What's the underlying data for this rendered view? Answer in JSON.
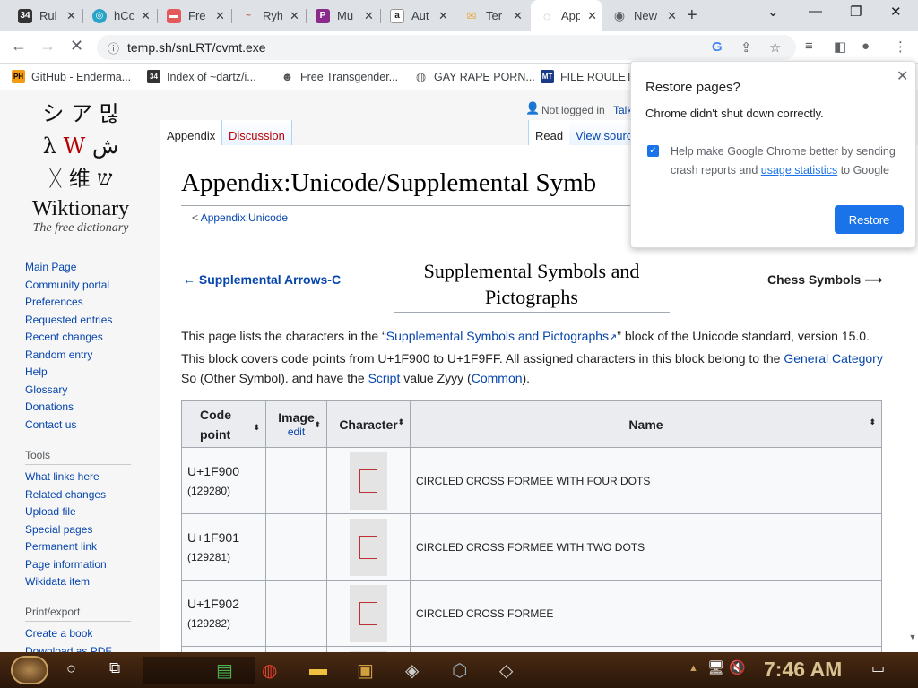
{
  "browser": {
    "tabs": [
      {
        "label": "Rul",
        "favicon": "34",
        "favicon_color": "#333333"
      },
      {
        "label": "hCo",
        "favicon": "◎",
        "favicon_color": "#2aa3c9"
      },
      {
        "label": "Fre",
        "favicon": "▬",
        "favicon_color": "#e45a5a"
      },
      {
        "label": "Ryh",
        "favicon": "~",
        "favicon_color": "#c06060"
      },
      {
        "label": "Mu",
        "favicon": "P",
        "favicon_color": "#8a2a8a"
      },
      {
        "label": "Aut",
        "favicon": "a",
        "favicon_color": "#222222"
      },
      {
        "label": "Ter",
        "favicon": "✉",
        "favicon_color": "#e8a838"
      },
      {
        "label": "App",
        "favicon": "◌",
        "favicon_color": "#9aa0a6"
      },
      {
        "label": "New Ta",
        "favicon": "◉",
        "favicon_color": "#5f6368"
      }
    ],
    "newtab_symbol": "+",
    "window_controls": [
      "⌄",
      "—",
      "❐",
      "✕"
    ],
    "url": "temp.sh/snLRT/cvmt.exe",
    "bookmarks": [
      {
        "label": "GitHub - Enderma...",
        "favicon": "PH",
        "favicon_color": "#f39c12"
      },
      {
        "label": "Index of ~dartz/i...",
        "favicon": "34",
        "favicon_color": "#333333"
      },
      {
        "label": "Free Transgender...",
        "favicon": "☻",
        "favicon_color": "#555555"
      },
      {
        "label": "GAY RAPE PORN...",
        "favicon": "◍",
        "favicon_color": "#666666"
      },
      {
        "label": "FILE ROULET",
        "favicon": "MT",
        "favicon_color": "#1a3a8a"
      }
    ]
  },
  "wiki": {
    "logo": {
      "glyph_rows": [
        [
          "シ",
          "ア",
          "믾"
        ],
        [
          "λ",
          "W",
          "ش"
        ],
        [
          "ᚷ",
          "维",
          "ש"
        ]
      ],
      "name": "Wiktionary",
      "tagline": "The free dictionary"
    },
    "nav_main": [
      "Main Page",
      "Community portal",
      "Preferences",
      "Requested entries",
      "Recent changes",
      "Random entry",
      "Help",
      "Glossary",
      "Donations",
      "Contact us"
    ],
    "tools_heading": "Tools",
    "nav_tools": [
      "What links here",
      "Related changes",
      "Upload file",
      "Special pages",
      "Permanent link",
      "Page information",
      "Wikidata item"
    ],
    "print_heading": "Print/export",
    "nav_print": [
      "Create a book",
      "Download as PDF"
    ],
    "user": {
      "not_logged_in": "Not logged in",
      "talk": "Talk"
    },
    "tabs": {
      "appendix": "Appendix",
      "discussion": "Discussion",
      "read": "Read",
      "view_source": "View sourc"
    },
    "title": "Appendix:Unicode/Supplemental Symb",
    "subnav_prefix": "< ",
    "subnav_link": "Appendix:Unicode",
    "prev_link": "← Supplemental Arrows-C",
    "next_link": "Chess Symbols ⟶",
    "center_title_1": "Supplemental Symbols and",
    "center_title_2": "Pictographs",
    "intro": {
      "p1": "This page lists the characters in the “",
      "link1": "Supplemental Symbols and Pictographs",
      "p2": "” block of the Unicode standard, version 15.0. This block covers code points from U+1F900 to U+1F9FF. All assigned characters in this block belong to the ",
      "link2": "General Category",
      "p3": " So (Other Symbol). and have the ",
      "link3": "Script",
      "p4": " value Zyyy (",
      "link4": "Common",
      "p5": ")."
    },
    "table": {
      "headers": {
        "code": "Code point",
        "image": "Image",
        "image_edit": "edit",
        "character": "Character",
        "name": "Name"
      },
      "sort_glyph": "⬍",
      "rows": [
        {
          "code": "U+1F900",
          "decimal": "(129280)",
          "name": "CIRCLED CROSS FORMEE WITH FOUR DOTS"
        },
        {
          "code": "U+1F901",
          "decimal": "(129281)",
          "name": "CIRCLED CROSS FORMEE WITH TWO DOTS"
        },
        {
          "code": "U+1F902",
          "decimal": "(129282)",
          "name": "CIRCLED CROSS FORMEE"
        }
      ]
    }
  },
  "popup": {
    "title": "Restore pages?",
    "message": "Chrome didn't shut down correctly.",
    "checkbox_text": "Help make Google Chrome better by sending crash reports and ",
    "checkbox_link": "usage statistics",
    "checkbox_suffix": " to Google",
    "button": "Restore",
    "accent": "#1a73e8"
  },
  "taskbar": {
    "clock": "7:46 AM"
  }
}
